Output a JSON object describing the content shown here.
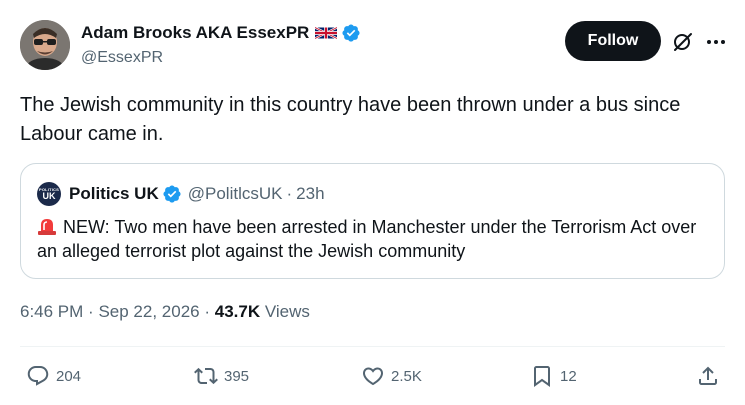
{
  "author": {
    "display_name": "Adam Brooks AKA EssexPR",
    "handle": "@EssexPR"
  },
  "follow_label": "Follow",
  "tweet_text": "The Jewish community in this country have been thrown under a bus since Labour came in.",
  "quote": {
    "avatar_small": "POLITICS",
    "avatar_big": "UK",
    "name": "Politics UK",
    "handle": "@PolitlcsUK",
    "separator": "·",
    "age": "23h",
    "text": "NEW: Two men have been arrested in Manchester under the Terrorism Act over an alleged terrorist plot against the Jewish community"
  },
  "meta": {
    "time": "6:46 PM",
    "sep1": "·",
    "date": "Sep 22, 2026",
    "sep2": "·",
    "views_count": "43.7K",
    "views_label": "Views"
  },
  "actions": {
    "replies": "204",
    "reposts": "395",
    "likes": "2.5K",
    "bookmarks": "12"
  },
  "colors": {
    "verified_blue": "#1d9bf0",
    "text_primary": "#0f1419",
    "text_secondary": "#536471",
    "border": "#cfd9de"
  },
  "icons": [
    "flag-uk-icon",
    "verified-badge-icon",
    "grok-icon",
    "more-icon",
    "siren-icon",
    "reply-icon",
    "repost-icon",
    "like-icon",
    "bookmark-icon",
    "share-icon"
  ]
}
